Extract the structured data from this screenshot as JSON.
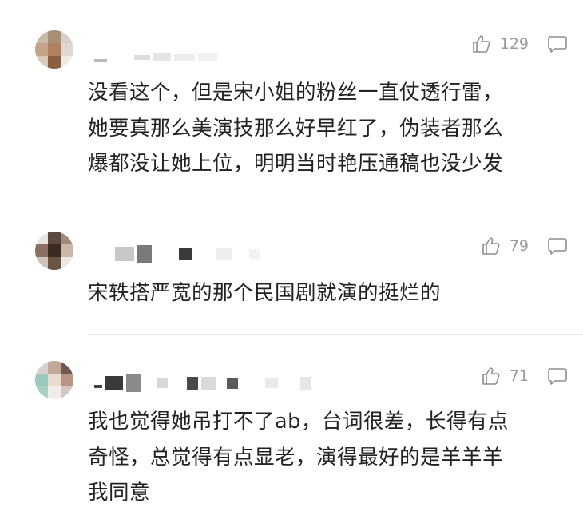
{
  "comments": [
    {
      "likes": "129",
      "text": "没看这个，但是宋小姐的粉丝一直仗透行雷，\n她要真那么美演技那么好早红了，伪装者那么\n爆都没让她上位，明明当时艳压通稿也没少发"
    },
    {
      "likes": "79",
      "text": "宋轶搭严宽的那个民国剧就演的挺烂的"
    },
    {
      "likes": "71",
      "text": "我也觉得她吊打不了ab，台词很差，长得有点\n奇怪，总觉得有点显老，演得最好的是羊羊羊\n我同意"
    }
  ],
  "icons": {
    "like": "thumbs-up-icon",
    "reply": "comment-bubble-icon"
  },
  "colors": {
    "text": "#222222",
    "meta": "#9a9a9a",
    "separator": "#e8e8e8"
  }
}
